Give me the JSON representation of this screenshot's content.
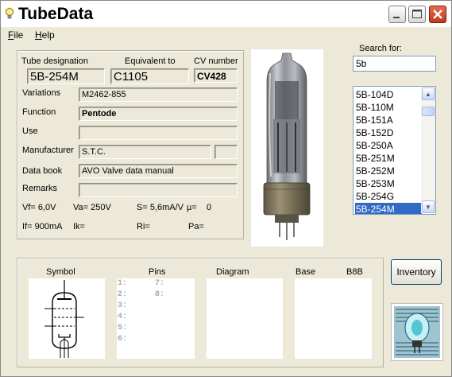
{
  "window": {
    "title": "TubeData"
  },
  "menu": [
    {
      "label": "File",
      "key": "F",
      "rest": "ile"
    },
    {
      "label": "Help",
      "key": "H",
      "rest": "elp"
    }
  ],
  "details": {
    "tube_designation_label": "Tube designation",
    "tube_designation": "5B-254M",
    "equivalent_label": "Equivalent to",
    "equivalent": "C1105",
    "cv_label": "CV number",
    "cv": "CV428",
    "variations_label": "Variations",
    "variations": "M2462-855",
    "function_label": "Function",
    "function": "Pentode",
    "use_label": "Use",
    "use": "",
    "manufacturer_label": "Manufacturer",
    "manufacturer": "S.T.C.",
    "manufacturer_code": "",
    "data_book_label": "Data book",
    "data_book": "AVO Valve data manual",
    "remarks_label": "Remarks",
    "remarks": ""
  },
  "params": {
    "vf": "Vf= 6,0V",
    "va": "Va= 250V",
    "s": "S= 5,6mA/V",
    "mu": "µ=",
    "mu_val": "0",
    "if": "If= 900mA",
    "ik": "Ik=",
    "ri": "Ri=",
    "pa": "Pa="
  },
  "search": {
    "label": "Search for:",
    "value": "5b"
  },
  "results": [
    "5B-104D",
    "5B-110M",
    "5B-151A",
    "5B-152D",
    "5B-250A",
    "5B-251M",
    "5B-252M",
    "5B-253M",
    "5B-254G",
    "5B-254M"
  ],
  "selected_index": 9,
  "bottom": {
    "symbol_label": "Symbol",
    "pins_label": "Pins",
    "diagram_label": "Diagram",
    "base_label": "Base",
    "base_value": "B8B",
    "pins_left": [
      "1:",
      "2:",
      "3:",
      "4:",
      "5:",
      "6:"
    ],
    "pins_right": [
      "7:",
      "8:"
    ]
  },
  "inventory_button": "Inventory",
  "colors": {
    "selection": "#316ac5",
    "close_button": "#c0391e",
    "window_bg": "#ece9d8"
  }
}
